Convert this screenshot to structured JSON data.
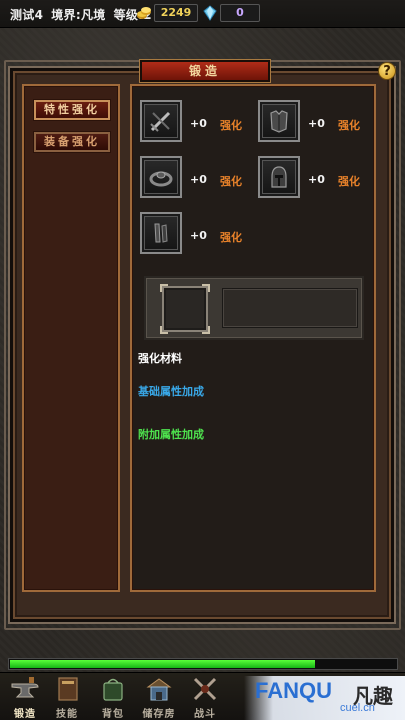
{
  "status": {
    "name": "测试4",
    "realm": "境界:凡境",
    "level": "等级:2",
    "gold": "2249",
    "gems": "0"
  },
  "panel": {
    "title": "锻造",
    "help": "?"
  },
  "tabs": [
    {
      "label": "特性强化",
      "active": true
    },
    {
      "label": "装备强化",
      "active": false
    }
  ],
  "slots": [
    {
      "icon": "sword-icon",
      "bonus": "+0",
      "action": "强化"
    },
    {
      "icon": "armor-icon",
      "bonus": "+0",
      "action": "强化"
    },
    {
      "icon": "ring-icon",
      "bonus": "+0",
      "action": "强化"
    },
    {
      "icon": "helmet-icon",
      "bonus": "+0",
      "action": "强化"
    },
    {
      "icon": "belt-icon",
      "bonus": "+0",
      "action": "强化"
    }
  ],
  "sections": {
    "materials": "强化材料",
    "base_attr": "基础属性加成",
    "extra_attr": "附加属性加成"
  },
  "progress": 0.79,
  "nav": [
    {
      "label": "锻造",
      "icon": "anvil-icon",
      "active": true
    },
    {
      "label": "技能",
      "icon": "book-icon",
      "active": false
    },
    {
      "label": "背包",
      "icon": "bag-icon",
      "active": false
    },
    {
      "label": "储存房",
      "icon": "storage-icon",
      "active": false
    },
    {
      "label": "战斗",
      "icon": "swords-icon",
      "active": false
    }
  ],
  "watermark": {
    "brand": "FANQU",
    "brand_cn": "凡趣",
    "site": "cuel.cn"
  },
  "colors": {
    "enhance": "#e9822a",
    "base_attr": "#39a8e8",
    "extra_attr": "#4ee24e",
    "progress": "#2ed42e"
  }
}
